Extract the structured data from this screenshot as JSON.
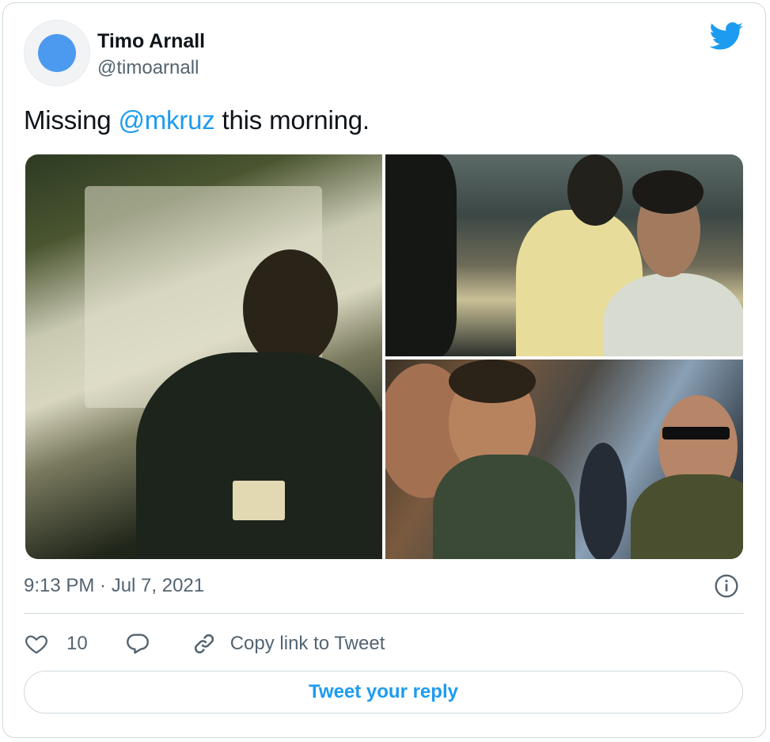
{
  "author": {
    "name": "Timo Arnall",
    "handle": "@timoarnall",
    "avatar_color": "#4c9af0"
  },
  "tweet": {
    "text_before": "Missing ",
    "mention": "@mkruz",
    "text_after": " this morning."
  },
  "media": {
    "photos": [
      {
        "name": "photo-man-laughing-under-tent"
      },
      {
        "name": "photo-crowd-at-party"
      },
      {
        "name": "photo-friends-laughing"
      }
    ]
  },
  "timestamp": "9:13 PM · Jul 7, 2021",
  "actions": {
    "like_count": "10",
    "copy_link_label": "Copy link to Tweet"
  },
  "reply_button_label": "Tweet your reply",
  "colors": {
    "accent": "#1d9bf0",
    "secondary_text": "#536471",
    "border": "#cfd9de"
  },
  "icons": [
    "twitter-bird-icon",
    "info-icon",
    "heart-icon",
    "reply-icon",
    "link-icon"
  ]
}
